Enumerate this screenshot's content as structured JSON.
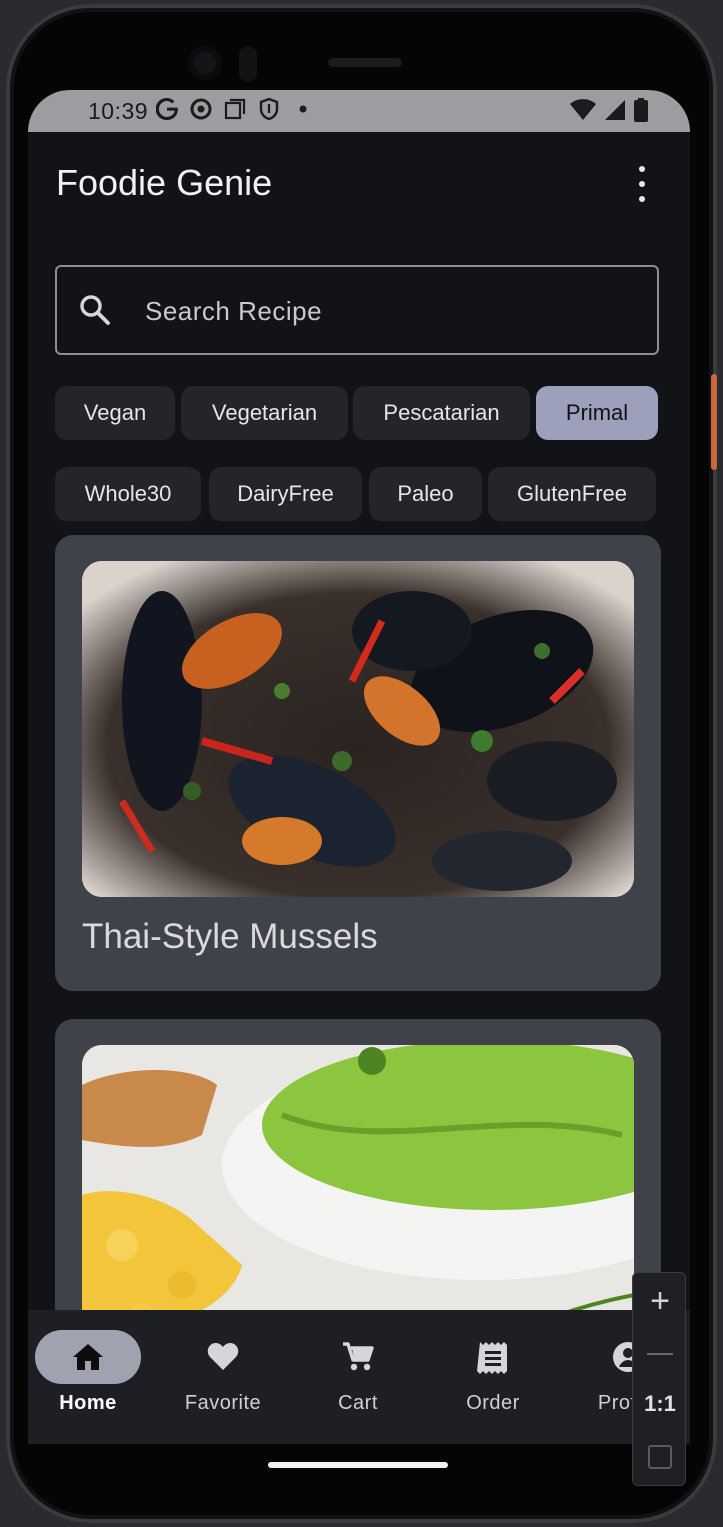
{
  "status_bar": {
    "time": "10:39",
    "left_icons": [
      "google-icon",
      "chrome-icon",
      "screenshot-icon",
      "shield-icon",
      "dot-icon"
    ],
    "right_icons": [
      "wifi-icon",
      "signal-icon",
      "battery-icon"
    ]
  },
  "app_bar": {
    "title": "Foodie Genie",
    "menu_icon": "more-vert-icon"
  },
  "search": {
    "placeholder": "Search Recipe",
    "icon": "search-icon"
  },
  "diet_chips": {
    "row1": [
      {
        "label": "Vegan",
        "selected": false
      },
      {
        "label": "Vegetarian",
        "selected": false
      },
      {
        "label": "Pescatarian",
        "selected": false
      },
      {
        "label": "Primal",
        "selected": true
      }
    ],
    "row2": [
      {
        "label": "Whole30",
        "selected": false
      },
      {
        "label": "DairyFree",
        "selected": false
      },
      {
        "label": "Paleo",
        "selected": false
      },
      {
        "label": "GlutenFree",
        "selected": false
      }
    ]
  },
  "recipes": [
    {
      "title": "Thai-Style Mussels",
      "image": "mussels-photo"
    },
    {
      "title": "",
      "image": "green-soup-photo"
    }
  ],
  "bottom_nav": [
    {
      "label": "Home",
      "icon": "home-icon",
      "active": true
    },
    {
      "label": "Favorite",
      "icon": "heart-icon",
      "active": false
    },
    {
      "label": "Cart",
      "icon": "cart-icon",
      "active": false
    },
    {
      "label": "Order",
      "icon": "receipt-icon",
      "active": false
    },
    {
      "label": "Profile",
      "icon": "profile-icon",
      "active": false
    }
  ],
  "emulator_zoom": {
    "zoom_in": "+",
    "ratio": "1:1"
  },
  "colors": {
    "background": "#121316",
    "card": "#404249",
    "chip": "#23252b",
    "chip_selected": "#9ca0bb",
    "nav_background": "#1e1f25"
  }
}
